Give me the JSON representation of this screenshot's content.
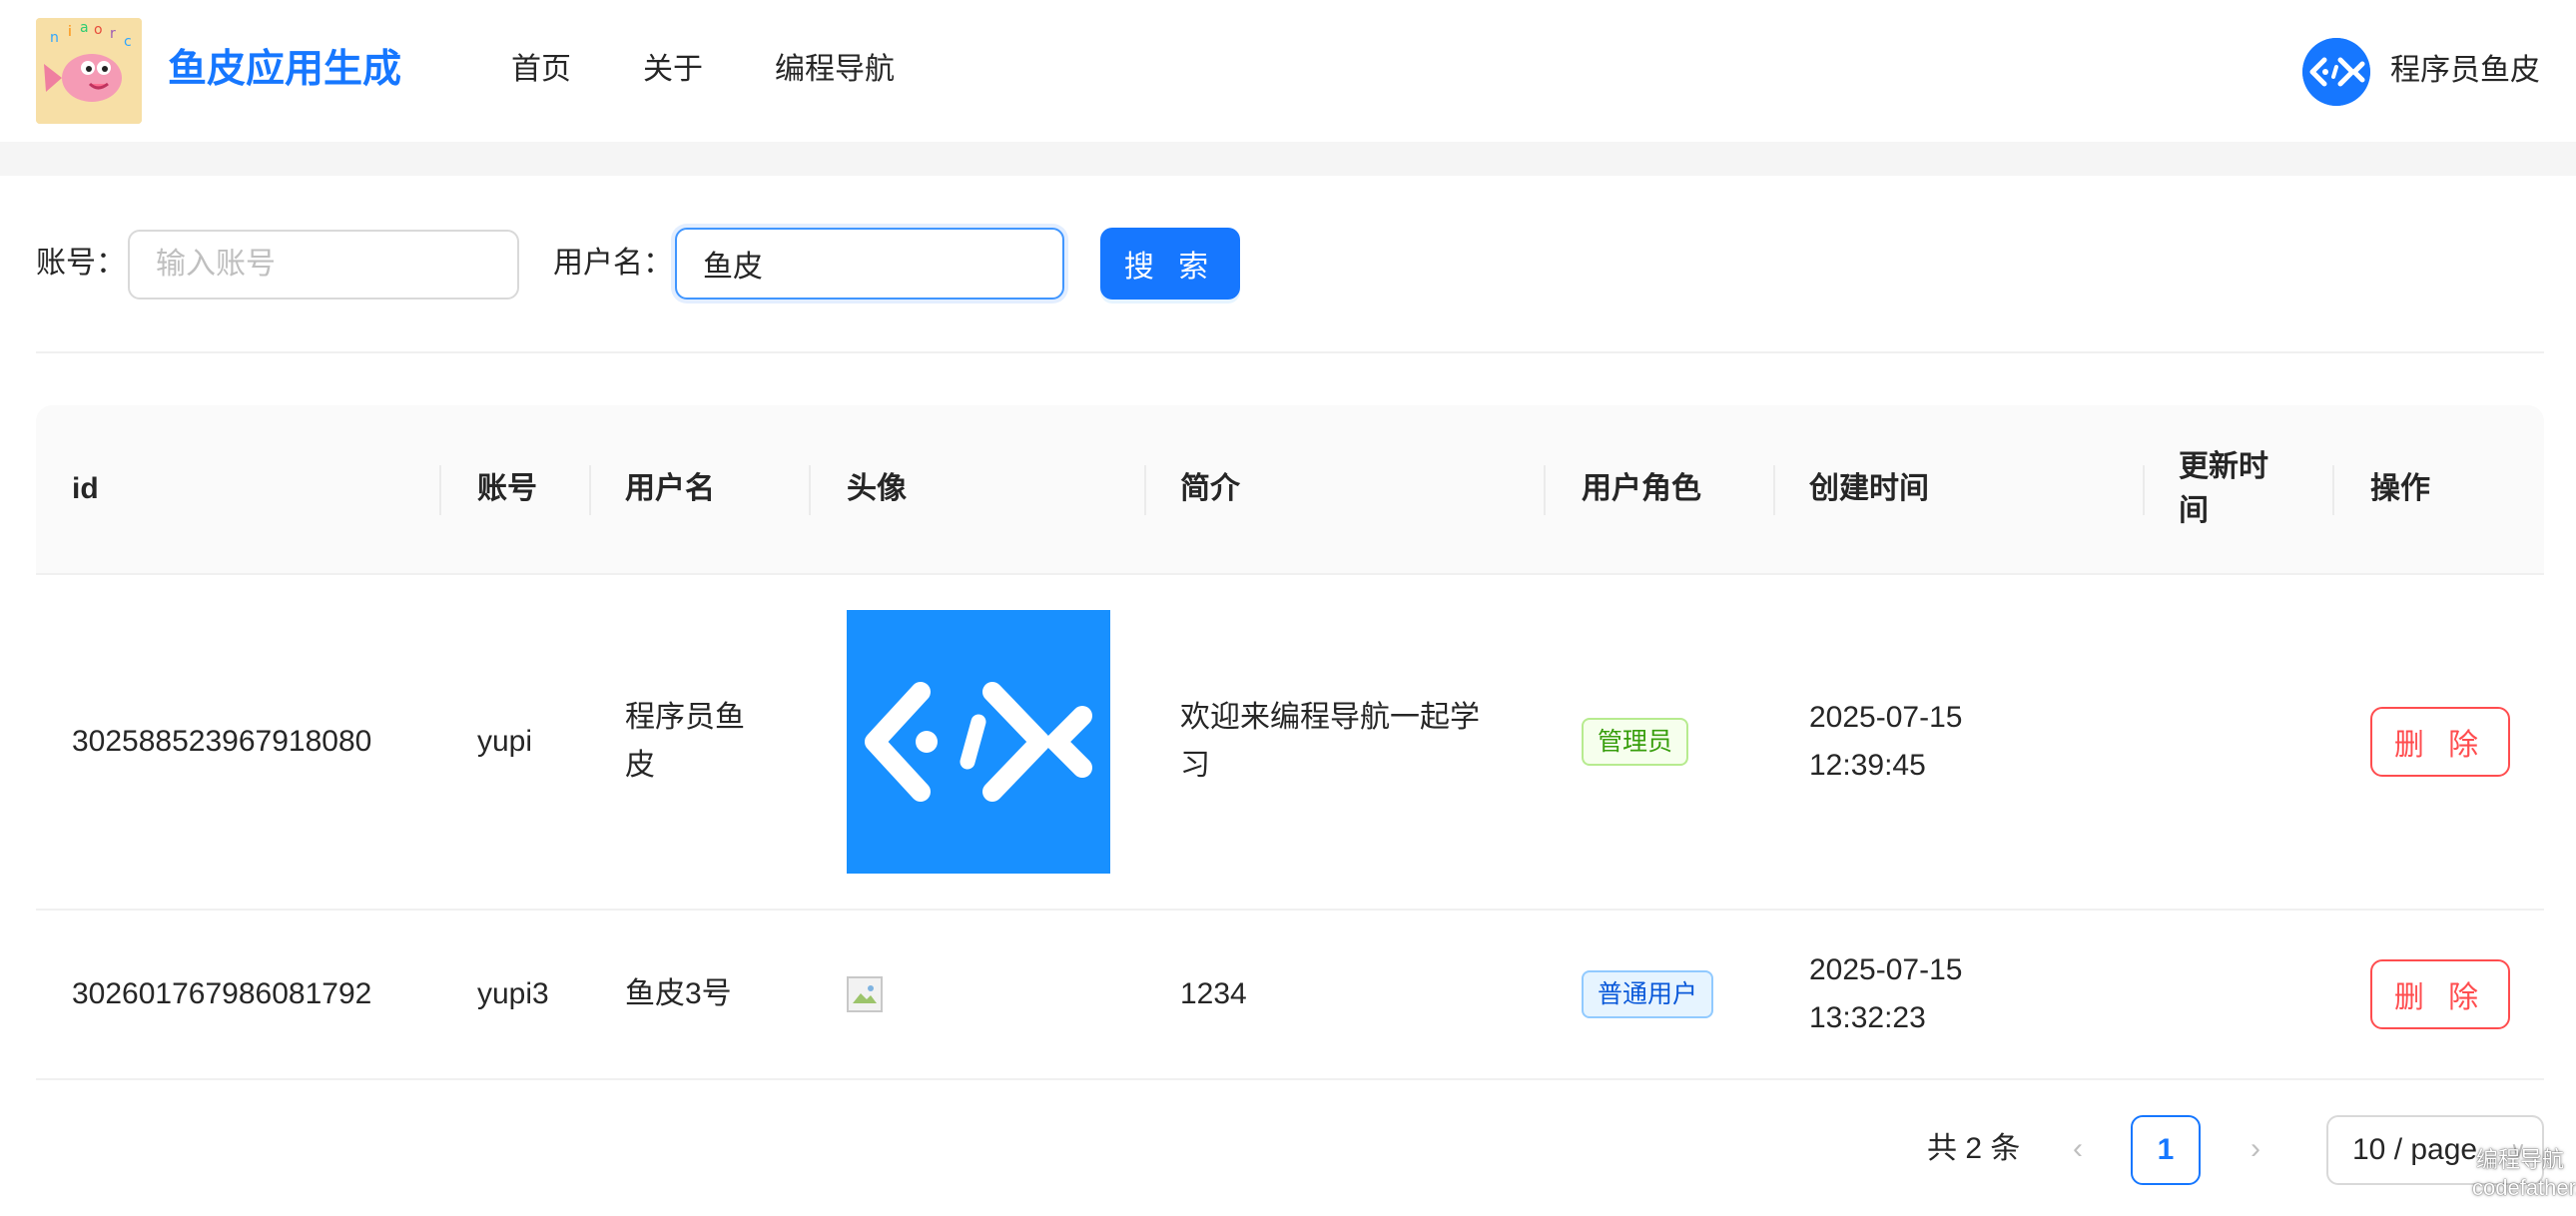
{
  "header": {
    "brand": "鱼皮应用生成",
    "nav": [
      "首页",
      "关于",
      "编程导航"
    ],
    "user_name": "程序员鱼皮"
  },
  "search": {
    "account_label": "账号：",
    "account_placeholder": "输入账号",
    "account_value": "",
    "username_label": "用户名：",
    "username_value": "鱼皮",
    "search_button": "搜 索"
  },
  "table": {
    "columns": [
      "id",
      "账号",
      "用户名",
      "头像",
      "简介",
      "用户角色",
      "创建时间",
      "更新时\n间",
      "操作"
    ],
    "rows": [
      {
        "id": "302588523967918080",
        "account": "yupi",
        "username": "程序员鱼\n皮",
        "avatar": "code-fish-logo",
        "intro": "欢迎来编程导航一起学\n习",
        "role": "管理员",
        "created": "2025-07-15\n12:39:45",
        "updated": "",
        "action": "删 除"
      },
      {
        "id": "302601767986081792",
        "account": "yupi3",
        "username": "鱼皮3号",
        "avatar": "broken-image",
        "intro": "1234",
        "role": "普通用户",
        "created": "2025-07-15\n13:32:23",
        "updated": "",
        "action": "删 除"
      }
    ]
  },
  "pagination": {
    "total": "共 2 条",
    "current": "1",
    "page_size": "10 / page"
  },
  "watermark": [
    "编程导航",
    "codefather.cn"
  ],
  "colors": {
    "primary": "#1677ff",
    "danger": "#ff4d4f",
    "admin_tag": "#389e0d",
    "user_tag": "#0958d9"
  }
}
